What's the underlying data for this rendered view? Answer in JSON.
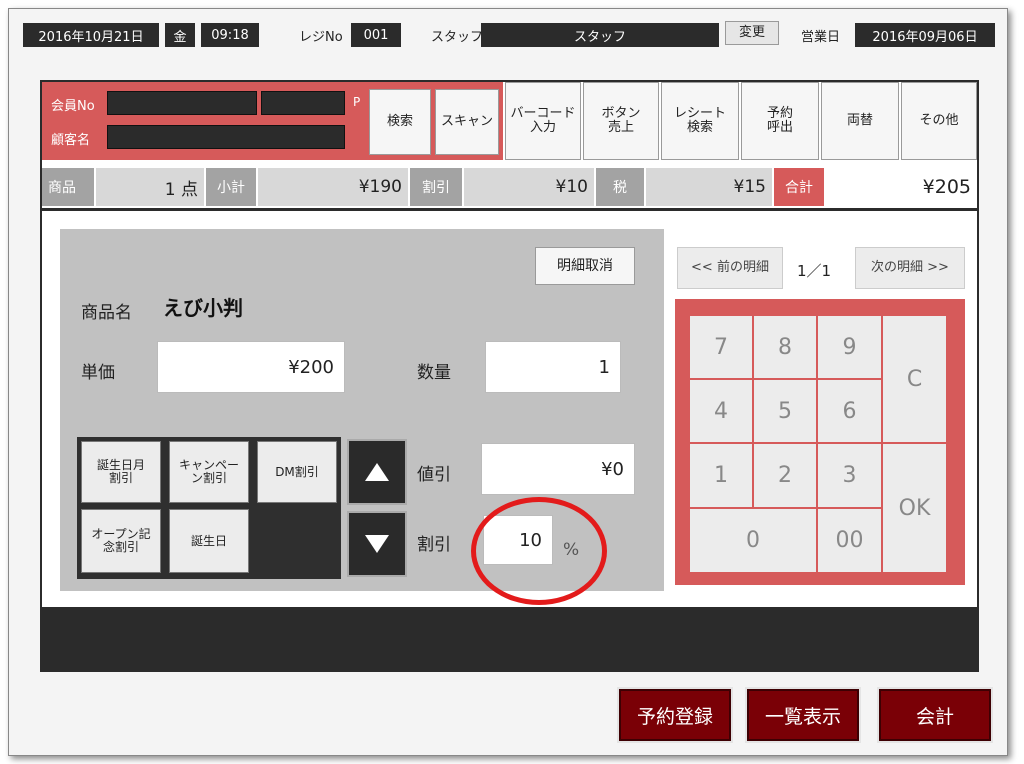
{
  "header": {
    "date": "2016年10月21日",
    "weekday": "金",
    "time": "09:18",
    "register_label": "レジNo",
    "register_no": "001",
    "staff_label": "スタッフ",
    "staff_name": "スタッフ",
    "change_button": "変更",
    "business_day_label": "営業日",
    "business_day": "2016年09月06日"
  },
  "member": {
    "member_no_label": "会員No",
    "customer_name_label": "顧客名",
    "points_label": "P",
    "search_button": "検索",
    "scan_button": "スキャン"
  },
  "function_buttons": [
    {
      "line1": "バーコード",
      "line2": "入力"
    },
    {
      "line1": "ボタン",
      "line2": "売上"
    },
    {
      "line1": "レシート",
      "line2": "検索"
    },
    {
      "line1": "予約",
      "line2": "呼出"
    },
    {
      "line1": "両替",
      "line2": ""
    },
    {
      "line1": "その他",
      "line2": ""
    }
  ],
  "summary": {
    "items_label": "商品",
    "items_count": "1 点",
    "subtotal_label": "小計",
    "subtotal": "¥190",
    "discount_label": "割引",
    "discount": "¥10",
    "tax_label": "税",
    "tax": "¥15",
    "total_label": "合計",
    "total": "¥205"
  },
  "detail": {
    "cancel_line_button": "明細取消",
    "product_name_label": "商品名",
    "product_name": "えび小判",
    "unit_price_label": "単価",
    "unit_price": "¥200",
    "quantity_label": "数量",
    "quantity": "1",
    "price_discount_label": "値引",
    "price_discount": "¥0",
    "percent_discount_label": "割引",
    "percent_discount": "10",
    "percent_sign": "%"
  },
  "discount_buttons": [
    {
      "line1": "誕生日月",
      "line2": "割引"
    },
    {
      "line1": "キャンペー",
      "line2": "ン割引"
    },
    {
      "line1": "DM割引",
      "line2": ""
    },
    {
      "line1": "オープン記",
      "line2": "念割引"
    },
    {
      "line1": "誕生日",
      "line2": ""
    }
  ],
  "pager": {
    "prev_button": "<< 前の明細",
    "page": "1／1",
    "next_button": "次の明細 >>"
  },
  "keypad": {
    "k7": "7",
    "k8": "8",
    "k9": "9",
    "clear": "C",
    "k4": "4",
    "k5": "5",
    "k6": "6",
    "k1": "1",
    "k2": "2",
    "k3": "3",
    "ok": "OK",
    "k0": "0",
    "k00": "00"
  },
  "footer": {
    "reserve_button": "予約登録",
    "list_button": "一覧表示",
    "checkout_button": "会計"
  },
  "colors": {
    "accent_red": "#d65a5a",
    "dark_red": "#7a0006",
    "annotation_circle": "#e31b1b"
  }
}
